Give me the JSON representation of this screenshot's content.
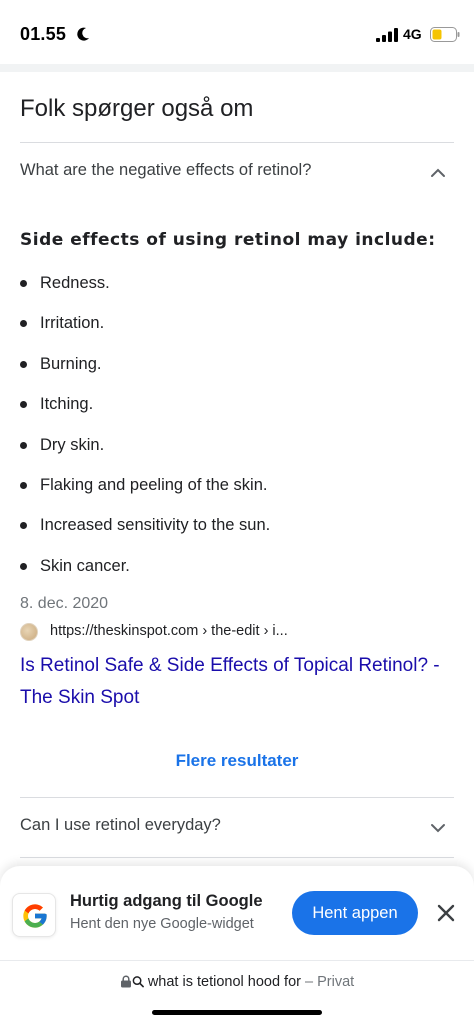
{
  "status_bar": {
    "time": "01.55",
    "network": "4G"
  },
  "section": {
    "title": "Folk spørger også om"
  },
  "questions": [
    {
      "text": "What are the negative effects of retinol?",
      "expanded": true
    },
    {
      "text": "Can I use retinol everyday?",
      "expanded": false
    }
  ],
  "answer": {
    "heading": "Side effects of using retinol may include:",
    "bullets": [
      "Redness.",
      "Irritation.",
      "Burning.",
      "Itching.",
      "Dry skin.",
      "Flaking and peeling of the skin.",
      "Increased sensitivity to the sun.",
      "Skin cancer."
    ],
    "date": "8. dec. 2020",
    "source_url": "https://theskinspot.com › the-edit › i...",
    "link_title": "Is Retinol Safe & Side Effects of Topical Retinol? - The Skin Spot"
  },
  "more_results": "Flere resultater",
  "promo": {
    "title": "Hurtig adgang til Google",
    "subtitle": "Hent den nye Google-widget",
    "button": "Hent appen"
  },
  "url_bar": {
    "query": "what is tetionol hood for",
    "separator": "–",
    "mode": "Privat"
  },
  "colors": {
    "link": "#1a0dab",
    "accent": "#1a73e8",
    "divider": "#dadce0"
  }
}
